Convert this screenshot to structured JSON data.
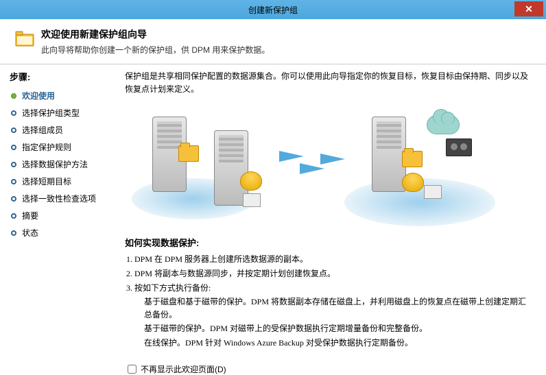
{
  "window": {
    "title": "创建新保护组"
  },
  "header": {
    "title": "欢迎使用新建保护组向导",
    "subtitle": "此向导将帮助你创建一个新的保护组，供 DPM 用来保护数据。"
  },
  "sidebar": {
    "title": "步骤:",
    "items": [
      {
        "label": "欢迎使用",
        "state": "current"
      },
      {
        "label": "选择保护组类型",
        "state": "pending"
      },
      {
        "label": "选择组成员",
        "state": "pending"
      },
      {
        "label": "指定保护规则",
        "state": "pending"
      },
      {
        "label": "选择数据保护方法",
        "state": "pending"
      },
      {
        "label": "选择短期目标",
        "state": "pending"
      },
      {
        "label": "选择一致性检查选项",
        "state": "pending"
      },
      {
        "label": "摘要",
        "state": "pending"
      },
      {
        "label": "状态",
        "state": "pending"
      }
    ]
  },
  "content": {
    "intro": "保护组是共享相同保护配置的数据源集合。你可以使用此向导指定你的恢复目标，恢复目标由保持期、同步以及恢复点计划来定义。",
    "section_title": "如何实现数据保护:",
    "list": {
      "item1": "1. DPM 在 DPM 服务器上创建所选数据源的副本。",
      "item2": "2. DPM 将副本与数据源同步，并按定期计划创建恢复点。",
      "item3": "3. 按如下方式执行备份:",
      "sub1": "基于磁盘和基于磁带的保护。DPM 将数据副本存储在磁盘上，并利用磁盘上的恢复点在磁带上创建定期汇总备份。",
      "sub2": "基于磁带的保护。DPM 对磁带上的受保护数据执行定期增量备份和完整备份。",
      "sub3": "在线保护。DPM 针对 Windows Azure Backup 对受保护数据执行定期备份。"
    },
    "checkbox_label": "不再显示此欢迎页面(D)"
  }
}
